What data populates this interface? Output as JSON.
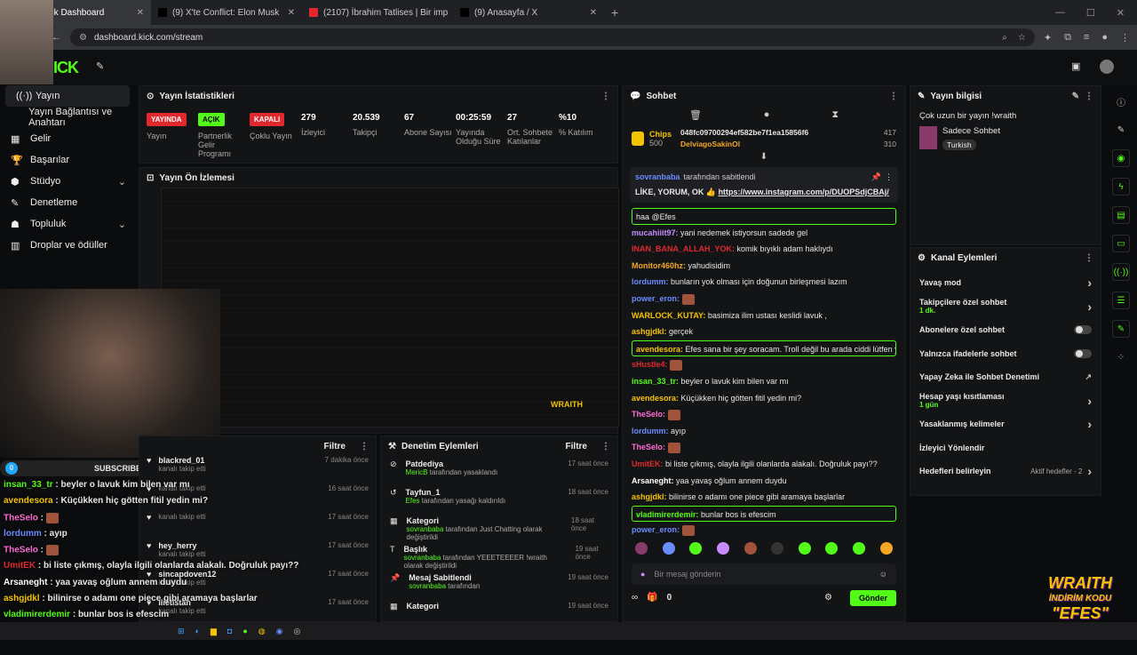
{
  "browser": {
    "tabs": [
      {
        "title": "am - Kick Dashboard"
      },
      {
        "title": "(9) X'te Conflict: Elon Musk"
      },
      {
        "title": "(2107) İbrahim Tatlises | Bir imp"
      },
      {
        "title": "(9) Anasayfa / X"
      }
    ],
    "url": "dashboard.kick.com/stream"
  },
  "sidebar": {
    "items": [
      {
        "label": "Yayın",
        "icon": "broadcast-icon"
      },
      {
        "label": "Yayın Bağlantısı ve Anahtarı",
        "icon": ""
      },
      {
        "label": "Gelir",
        "icon": "revenue-icon"
      },
      {
        "label": "Başarılar",
        "icon": "trophy-icon"
      },
      {
        "label": "Stüdyo",
        "icon": "studio-icon"
      },
      {
        "label": "Denetleme",
        "icon": "hammer-icon"
      },
      {
        "label": "Topluluk",
        "icon": "community-icon"
      },
      {
        "label": "Droplar ve ödüller",
        "icon": "gift-icon"
      }
    ]
  },
  "stats": {
    "title": "Yayın İstatistikleri",
    "items": [
      {
        "pill": "YAYINDA",
        "pill_color": "#e0282e",
        "label": "Yayın"
      },
      {
        "pill": "AÇIK",
        "pill_color": "#53fc18",
        "label": "Partnerlik Gelir Programı"
      },
      {
        "pill": "KAPALI",
        "pill_color": "#e0282e",
        "label": "Çoklu Yayın"
      },
      {
        "value": "279",
        "label": "İzleyici"
      },
      {
        "value": "20.539",
        "label": "Takipçi"
      },
      {
        "value": "67",
        "label": "Abone Sayısı"
      },
      {
        "value": "00:25:59",
        "label": "Yayında Olduğu Süre"
      },
      {
        "value": "27",
        "label": "Ort. Sohbete Katılanlar"
      },
      {
        "value": "%10",
        "label": "% Katılım"
      }
    ]
  },
  "preview": {
    "title": "Yayın Ön İzlemesi"
  },
  "overlay": {
    "subscribers_label": "SUBSCRIBERS",
    "subscribers_count": "0",
    "chat": [
      {
        "user": "insan_33_tr",
        "text": "beyler o lavuk kim bilen var mı",
        "color": "#53fc18"
      },
      {
        "user": "avendesora",
        "text": "Küçükken hiç götten fitil yedin mi?",
        "color": "#f5c400"
      },
      {
        "user": "TheSelo",
        "text": "",
        "color": "#ff6bd5"
      },
      {
        "user": "lordumm",
        "text": "ayıp",
        "color": "#6a8cff"
      },
      {
        "user": "TheSelo",
        "text": "",
        "color": "#ff6bd5"
      },
      {
        "user": "UmitEK",
        "text": "bi liste çıkmış, olayla ilgili olanlarda alakalı. Doğruluk payı??",
        "color": "#e0282e"
      },
      {
        "user": "Arsaneght",
        "text": "yaa yavaş oğlum annem duydu",
        "color": "#ffffff"
      },
      {
        "user": "ashgjdkl",
        "text": "bilinirse o adamı one piece gibi aramaya başlarlar",
        "color": "#f5c400"
      },
      {
        "user": "vladimirerdemir",
        "text": "bunlar bos is efescim",
        "color": "#53fc18"
      }
    ]
  },
  "activity": {
    "filter_label": "Filtre",
    "rows": [
      {
        "name": "blackred_01",
        "sub": "kanalı takip etti",
        "time": "7 dakika önce",
        "badge": "7"
      },
      {
        "name": "",
        "sub": "kanalı takip etti",
        "time": "16 saat önce"
      },
      {
        "name": "",
        "sub": "kanalı takip etti",
        "time": "17 saat önce"
      },
      {
        "name": "hey_herry",
        "sub": "kanalı takip etti",
        "time": "17 saat önce"
      },
      {
        "name": "sincapdoven12",
        "sub": "kanalı takip etti",
        "time": "17 saat önce"
      },
      {
        "name": "ilietistan",
        "sub": "kanalı takip etti",
        "time": "17 saat önce"
      },
      {
        "name": "Alanseal yeniden abone oldu!",
        "sub": "",
        "time": "18 saat önce"
      }
    ]
  },
  "moderation": {
    "title": "Denetim Eylemleri",
    "filter_label": "Filtre",
    "rows": [
      {
        "name": "Patdediya",
        "actor": "MericB",
        "sub": "tarafından yasaklandı",
        "time": "17 saat önce",
        "icon": "ban-icon"
      },
      {
        "name": "Tayfun_1",
        "actor": "Efes",
        "sub": "tarafından yasağı kaldırıldı",
        "time": "18 saat önce",
        "icon": "undo-icon"
      },
      {
        "name": "Kategori",
        "actor": "sovranbaba",
        "sub": "tarafından Just Chatting olarak değiştirildi",
        "time": "18 saat önce",
        "icon": "category-icon"
      },
      {
        "name": "Başlık",
        "actor": "sovranbaba",
        "sub": "tarafından YEEETEEEER !wraith olarak değiştirildi",
        "time": "19 saat önce",
        "icon": "title-icon"
      },
      {
        "name": "Mesaj Sabitlendi",
        "actor": "sovranbaba",
        "sub": "tarafından",
        "time": "19 saat önce",
        "icon": "pin-icon"
      },
      {
        "name": "Kategori",
        "actor": "",
        "sub": "",
        "time": "19 saat önce",
        "icon": "category-icon"
      }
    ]
  },
  "chat": {
    "title": "Sohbet",
    "chips_label": "Chips",
    "chips_amount": "500",
    "top_user1": "048fc09700294ef582be7f1ea15856f6",
    "top_user1_amount": "417",
    "top_user2": "DelviagoSakinOl",
    "top_user2_amount": "310",
    "pinned_by": "sovranbaba",
    "pinned_suffix": "tarafından sabitlendi",
    "pinned_text": "LİKE, YORUM, OK 👍",
    "pinned_link": "https://www.instagram.com/p/DUOPSdjCBAj/",
    "messages": [
      {
        "user": "",
        "text": "haa @Efes",
        "color": "#6a8cff",
        "hl": true
      },
      {
        "user": "mucahiiit97:",
        "text": "yani nedemek istiyorsun sadede gel",
        "color": "#c98bff"
      },
      {
        "user": "INAN_BANA_ALLAH_YOK:",
        "text": "komik bıyıklı adam haklıydı",
        "color": "#e0282e"
      },
      {
        "user": "Monitor460hz:",
        "text": "yahudisidim",
        "color": "#f5a623"
      },
      {
        "user": "lordumm:",
        "text": "bunların yok olması için doğunun birleşmesi lazım",
        "color": "#6a8cff"
      },
      {
        "user": "power_eron:",
        "text": "",
        "color": "#6a8cff",
        "emote": true
      },
      {
        "user": "WARLOCK_KUTAY:",
        "text": "basimiza ilim ustası keslidi lavuk ,",
        "color": "#f5c400"
      },
      {
        "user": "ashgjdkl:",
        "text": "gerçek",
        "color": "#f5c400"
      },
      {
        "user": "avendesora:",
        "text": "Efes sana bir şey soracam. Troll değil bu arada ciddi lütfen yanıtla",
        "color": "#f5c400",
        "hl": true
      },
      {
        "user": "sHustle4:",
        "text": "",
        "color": "#e0282e",
        "emote": true
      },
      {
        "user": "insan_33_tr:",
        "text": "beyler o lavuk kim bilen var mı",
        "color": "#53fc18"
      },
      {
        "user": "avendesora:",
        "text": "Küçükken hiç götten fitil yedin mi?",
        "color": "#f5c400"
      },
      {
        "user": "TheSelo:",
        "text": "",
        "color": "#ff6bd5",
        "emote": true
      },
      {
        "user": "lordumm:",
        "text": "ayıp",
        "color": "#6a8cff"
      },
      {
        "user": "TheSelo:",
        "text": "",
        "color": "#ff6bd5",
        "emote": true
      },
      {
        "user": "UmitEK:",
        "text": "bi liste çıkmış, olayla ilgili olanlarda alakalı. Doğruluk payı??",
        "color": "#e0282e"
      },
      {
        "user": "Arsaneght:",
        "text": "yaa yavaş oğlum annem duydu",
        "color": "#ffffff"
      },
      {
        "user": "ashgjdkl:",
        "text": "bilinirse o adamı one piece gibi aramaya başlarlar",
        "color": "#f5c400"
      },
      {
        "user": "vladimirerdemir:",
        "text": "bunlar bos is efescim",
        "color": "#53fc18",
        "hl": true
      },
      {
        "user": "power_eron:",
        "text": "",
        "color": "#6a8cff",
        "emote": true
      }
    ],
    "input_placeholder": "Bir mesaj gönderin",
    "points": "0",
    "send_label": "Gönder"
  },
  "info": {
    "title": "Yayın bilgisi",
    "stream_title": "Çok uzun bir yayın !wraith",
    "category": "Sadece Sohbet",
    "tag": "Turkish"
  },
  "channel": {
    "title": "Kanal Eylemleri",
    "rows": [
      {
        "label": "Yavaş mod",
        "sub": "",
        "right": "chevron"
      },
      {
        "label": "Takipçilere özel sohbet",
        "sub": "1 dk.",
        "right": "chevron"
      },
      {
        "label": "Abonelere özel sohbet",
        "sub": "",
        "right": "toggle"
      },
      {
        "label": "Yalnızca ifadelerle sohbet",
        "sub": "",
        "right": "toggle"
      },
      {
        "label": "Yapay Zeka ile Sohbet Denetimi",
        "sub": "",
        "right": "external"
      },
      {
        "label": "Hesap yaşı kısıtlaması",
        "sub": "1 gün",
        "right": "chevron"
      },
      {
        "label": "Yasaklanmış kelimeler",
        "sub": "",
        "right": "chevron"
      },
      {
        "label": "İzleyici Yönlendir",
        "sub": "",
        "right": ""
      },
      {
        "label": "Hedefleri belirleyin",
        "sub": "",
        "right": "chevron",
        "extra": "Aktif hedefler - 2"
      }
    ]
  },
  "promo": {
    "line1": "WRAITH",
    "line2": "İNDİRİM KODU",
    "line3": "\"EFES\""
  }
}
